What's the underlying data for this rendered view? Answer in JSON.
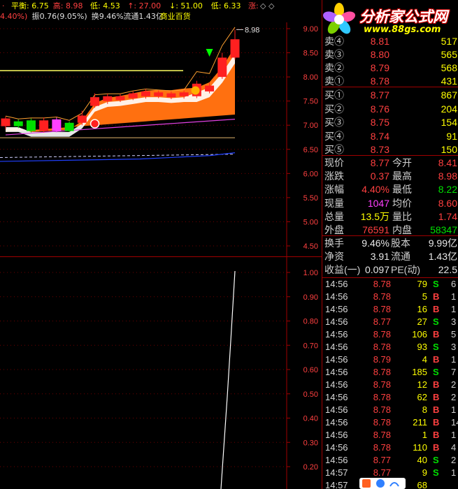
{
  "topbar": {
    "line1": [
      {
        "text": "平衡: 6.75",
        "color": "#ffff00"
      },
      {
        "text": "高: 8.98",
        "color": "#ff4040"
      },
      {
        "text": "低: 4.53",
        "color": "#ffff00"
      },
      {
        "text": "↑: 27.00",
        "color": "#ff4040"
      },
      {
        "text": "↓: 51.00",
        "color": "#ffff00"
      },
      {
        "text": "低: 6.33",
        "color": "#ffff00"
      },
      {
        "text": "涨:",
        "color": "#ff4040"
      }
    ],
    "line1_icons": [
      "◇",
      "◇"
    ],
    "line2": [
      {
        "text": "4.40%)",
        "color": "#ff4040"
      },
      {
        "text": "振0.76(9.05%)",
        "color": "#e0e0e0"
      },
      {
        "text": "换9.46%",
        "color": "#e0e0e0"
      },
      {
        "text": "流通1.43亿",
        "color": "#e0e0e0"
      },
      {
        "text": "商业百货",
        "color": "#ffff00"
      }
    ]
  },
  "kline": {
    "y_ticks": [
      "9.00",
      "8.50",
      "8.00",
      "7.50",
      "7.00",
      "6.50",
      "6.00",
      "5.50",
      "5.00",
      "4.50"
    ],
    "high_label": "8.98",
    "candles": [
      {
        "o": 6.98,
        "c": 7.14,
        "h": 7.18,
        "l": 6.92
      },
      {
        "o": 7.08,
        "c": 6.98,
        "h": 7.12,
        "l": 6.94
      },
      {
        "o": 7.1,
        "c": 6.88,
        "h": 7.14,
        "l": 6.85
      },
      {
        "o": 6.88,
        "c": 7.1,
        "h": 7.16,
        "l": 6.85
      },
      {
        "o": 7.12,
        "c": 6.88,
        "h": 7.16,
        "l": 6.85
      },
      {
        "o": 7.05,
        "c": 6.88,
        "h": 7.08,
        "l": 6.86
      },
      {
        "o": 7.05,
        "c": 7.2,
        "h": 7.3,
        "l": 7.0
      },
      {
        "o": 7.4,
        "c": 7.58,
        "h": 7.66,
        "l": 7.36
      },
      {
        "o": 7.5,
        "c": 7.6,
        "h": 7.65,
        "l": 7.44
      },
      {
        "o": 7.52,
        "c": 7.6,
        "h": 7.64,
        "l": 7.48
      },
      {
        "o": 7.56,
        "c": 7.66,
        "h": 7.7,
        "l": 7.52
      },
      {
        "o": 7.6,
        "c": 7.7,
        "h": 7.75,
        "l": 7.55
      },
      {
        "o": 7.6,
        "c": 7.68,
        "h": 7.72,
        "l": 7.56
      },
      {
        "o": 7.58,
        "c": 7.66,
        "h": 7.7,
        "l": 7.54
      },
      {
        "o": 7.6,
        "c": 7.68,
        "h": 7.72,
        "l": 7.55
      },
      {
        "o": 7.6,
        "c": 7.86,
        "h": 7.92,
        "l": 7.56
      },
      {
        "o": 7.7,
        "c": 7.82,
        "h": 7.88,
        "l": 7.66
      },
      {
        "o": 8.0,
        "c": 8.4,
        "h": 8.5,
        "l": 7.96
      },
      {
        "o": 8.4,
        "c": 8.78,
        "h": 8.98,
        "l": 8.36
      }
    ],
    "hline_value": 8.13,
    "low_line_value": 6.74
  },
  "subchart": {
    "y_ticks": [
      "1.00",
      "0.90",
      "0.80",
      "0.70",
      "0.60",
      "0.50",
      "0.40",
      "0.30",
      "0.20"
    ]
  },
  "panel": {
    "sell": [
      {
        "label": "卖④",
        "price": "8.81",
        "vol": "517"
      },
      {
        "label": "卖③",
        "price": "8.80",
        "vol": "565"
      },
      {
        "label": "卖②",
        "price": "8.79",
        "vol": "568"
      },
      {
        "label": "卖①",
        "price": "8.78",
        "vol": "431"
      }
    ],
    "buy": [
      {
        "label": "买①",
        "price": "8.77",
        "vol": "867"
      },
      {
        "label": "买②",
        "price": "8.76",
        "vol": "204"
      },
      {
        "label": "买③",
        "price": "8.75",
        "vol": "154"
      },
      {
        "label": "买④",
        "price": "8.74",
        "vol": "91"
      },
      {
        "label": "买⑤",
        "price": "8.73",
        "vol": "150"
      }
    ],
    "stats": [
      {
        "l1": "现价",
        "v1": "8.77",
        "c1": "#ff4040",
        "l2": "今开",
        "v2": "8.41",
        "c2": "#ff4040"
      },
      {
        "l1": "涨跌",
        "v1": "0.37",
        "c1": "#ff4040",
        "l2": "最高",
        "v2": "8.98",
        "c2": "#ff4040"
      },
      {
        "l1": "涨幅",
        "v1": "4.40%",
        "c1": "#ff4040",
        "l2": "最低",
        "v2": "8.22",
        "c2": "#00e000"
      },
      {
        "l1": "现量",
        "v1": "1047",
        "c1": "#ff40ff",
        "l2": "均价",
        "v2": "8.60",
        "c2": "#ff4040"
      },
      {
        "l1": "总量",
        "v1": "13.5万",
        "c1": "#ffff00",
        "l2": "量比",
        "v2": "1.74",
        "c2": "#ff4040"
      },
      {
        "l1": "外盘",
        "v1": "76591",
        "c1": "#ff4040",
        "l2": "内盘",
        "v2": "58347",
        "c2": "#00e000"
      }
    ],
    "fin": [
      {
        "l1": "换手",
        "v1": "9.46%",
        "l2": "股本",
        "v2": "9.99亿"
      },
      {
        "l1": "净资",
        "v1": "3.91",
        "l2": "流通",
        "v2": "1.43亿"
      },
      {
        "l1": "收益(一)",
        "v1": "0.097",
        "l2": "PE(动)",
        "v2": "22.5"
      }
    ],
    "ticks": [
      {
        "time": "14:56",
        "price": "8.78",
        "pc": "#ff4040",
        "vol": "79",
        "bs": "S",
        "cnt": "6"
      },
      {
        "time": "14:56",
        "price": "8.78",
        "pc": "#ff4040",
        "vol": "5",
        "bs": "B",
        "cnt": "1"
      },
      {
        "time": "14:56",
        "price": "8.78",
        "pc": "#ff4040",
        "vol": "16",
        "bs": "B",
        "cnt": "1"
      },
      {
        "time": "14:56",
        "price": "8.77",
        "pc": "#ff4040",
        "vol": "27",
        "bs": "S",
        "cnt": "3"
      },
      {
        "time": "14:56",
        "price": "8.78",
        "pc": "#ff4040",
        "vol": "106",
        "bs": "B",
        "cnt": "5"
      },
      {
        "time": "14:56",
        "price": "8.78",
        "pc": "#ff4040",
        "vol": "93",
        "bs": "S",
        "cnt": "3"
      },
      {
        "time": "14:56",
        "price": "8.79",
        "pc": "#ff4040",
        "vol": "4",
        "bs": "B",
        "cnt": "1"
      },
      {
        "time": "14:56",
        "price": "8.78",
        "pc": "#ff4040",
        "vol": "185",
        "bs": "S",
        "cnt": "7"
      },
      {
        "time": "14:56",
        "price": "8.78",
        "pc": "#ff4040",
        "vol": "12",
        "bs": "B",
        "cnt": "2"
      },
      {
        "time": "14:56",
        "price": "8.78",
        "pc": "#ff4040",
        "vol": "62",
        "bs": "B",
        "cnt": "2"
      },
      {
        "time": "14:56",
        "price": "8.78",
        "pc": "#ff4040",
        "vol": "8",
        "bs": "B",
        "cnt": "1"
      },
      {
        "time": "14:56",
        "price": "8.78",
        "pc": "#ff4040",
        "vol": "211",
        "bs": "B",
        "cnt": "14"
      },
      {
        "time": "14:56",
        "price": "8.78",
        "pc": "#ff4040",
        "vol": "1",
        "bs": "B",
        "cnt": "1"
      },
      {
        "time": "14:56",
        "price": "8.78",
        "pc": "#ff4040",
        "vol": "110",
        "bs": "B",
        "cnt": "4"
      },
      {
        "time": "14:56",
        "price": "8.77",
        "pc": "#ff4040",
        "vol": "40",
        "bs": "S",
        "cnt": "2"
      },
      {
        "time": "14:57",
        "price": "8.77",
        "pc": "#ff4040",
        "vol": "9",
        "bs": "S",
        "cnt": "1"
      },
      {
        "time": "14:57",
        "price": "",
        "pc": "#ff4040",
        "vol": "68",
        "bs": "",
        "cnt": ""
      }
    ]
  },
  "logo": {
    "name": "分析家公式网",
    "url": "www.88gs.com"
  },
  "colors": {
    "up": "#ff4040",
    "down": "#00e000",
    "grid": "#a00000",
    "volume": "#ffff00"
  }
}
